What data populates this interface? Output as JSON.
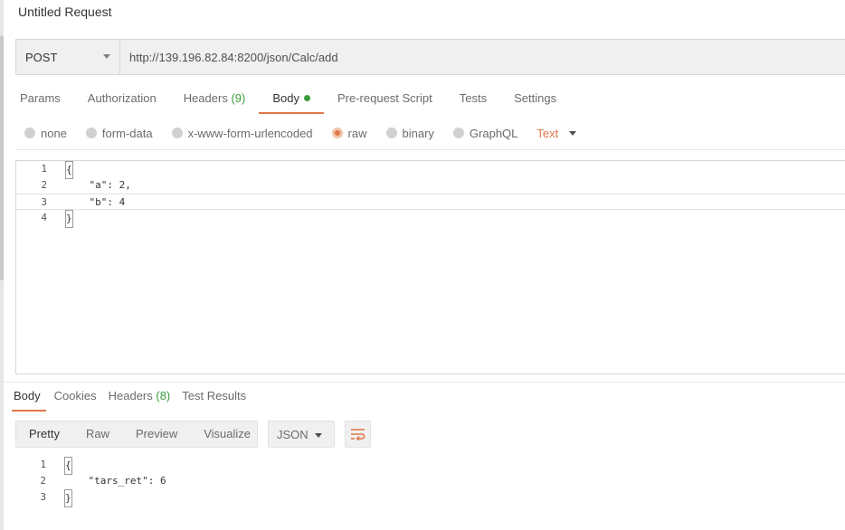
{
  "request": {
    "title": "Untitled Request",
    "method": "POST",
    "url": "http://139.196.82.84:8200/json/Calc/add"
  },
  "request_tabs": [
    {
      "label": "Params"
    },
    {
      "label": "Authorization"
    },
    {
      "label": "Headers",
      "count": "(9)"
    },
    {
      "label": "Body"
    },
    {
      "label": "Pre-request Script"
    },
    {
      "label": "Tests"
    },
    {
      "label": "Settings"
    }
  ],
  "body_types": [
    {
      "label": "none"
    },
    {
      "label": "form-data"
    },
    {
      "label": "x-www-form-urlencoded"
    },
    {
      "label": "raw"
    },
    {
      "label": "binary"
    },
    {
      "label": "GraphQL"
    }
  ],
  "raw_format": "Text",
  "request_body": {
    "lines": [
      {
        "num": "1",
        "text": "{"
      },
      {
        "num": "2",
        "text": "    \"a\": 2,"
      },
      {
        "num": "3",
        "text": "    \"b\": 4"
      },
      {
        "num": "4",
        "text": "}"
      }
    ]
  },
  "response_tabs": [
    {
      "label": "Body"
    },
    {
      "label": "Cookies"
    },
    {
      "label": "Headers",
      "count": "(8)"
    },
    {
      "label": "Test Results"
    }
  ],
  "view_modes": [
    {
      "label": "Pretty"
    },
    {
      "label": "Raw"
    },
    {
      "label": "Preview"
    },
    {
      "label": "Visualize"
    }
  ],
  "response_format": "JSON",
  "response_body": {
    "lines": [
      {
        "num": "1",
        "text": "{"
      },
      {
        "num": "2",
        "text": "    \"tars_ret\": 6"
      },
      {
        "num": "3",
        "text": "}"
      }
    ]
  },
  "colors": {
    "accent": "#e0774a",
    "count_green": "#3c9b3c"
  },
  "icons": [
    "caret-down-icon",
    "wrap-lines-icon"
  ]
}
